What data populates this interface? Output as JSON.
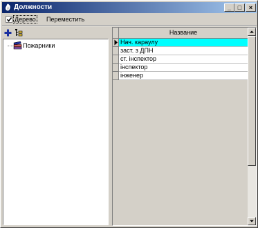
{
  "window": {
    "title": "Должности",
    "controls": {
      "minimize": "_",
      "maximize": "□",
      "close": "×"
    }
  },
  "toolbar": {
    "tree_checkbox": {
      "label": "Дерево",
      "checked": true
    },
    "move_label": "Переместить"
  },
  "tree_toolbar": {
    "icons": [
      "add-icon",
      "tree-structure-icon"
    ]
  },
  "tree": {
    "items": [
      {
        "label": "Пожарники",
        "icon": "books-icon"
      }
    ]
  },
  "grid": {
    "column_header": "Название",
    "rows": [
      {
        "name": "Нач. караулу",
        "selected": true
      },
      {
        "name": "заст. з ДПН",
        "selected": false
      },
      {
        "name": "ст. інспектор",
        "selected": false
      },
      {
        "name": "інспектор",
        "selected": false
      },
      {
        "name": "інженер",
        "selected": false
      }
    ],
    "selection_color": "#00ffff"
  },
  "colors": {
    "titlebar_start": "#0a246a",
    "titlebar_end": "#a6caf0",
    "face": "#d4d0c8"
  }
}
